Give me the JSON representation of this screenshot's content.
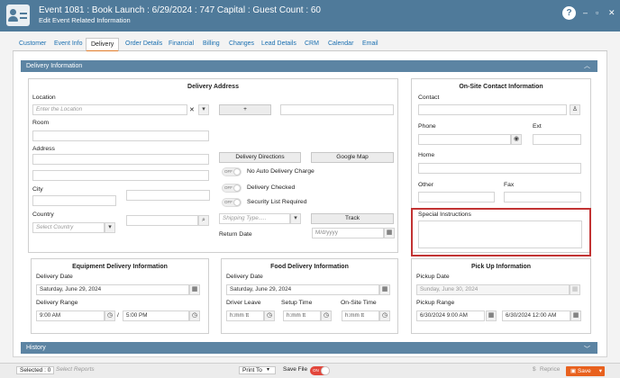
{
  "header": {
    "title": "Event 1081 : Book Launch : 6/29/2024 : 747 Capital : Guest Count : 60",
    "subtitle": "Edit Event Related Information",
    "help": "?",
    "minimize": "–",
    "restore": "▫",
    "close": "✕"
  },
  "tabs": [
    {
      "label": "Customer"
    },
    {
      "label": "Event Info"
    },
    {
      "label": "Delivery"
    },
    {
      "label": "Order Details"
    },
    {
      "label": "Financial"
    },
    {
      "label": "Billing"
    },
    {
      "label": "Changes"
    },
    {
      "label": "Lead Details"
    },
    {
      "label": "CRM"
    },
    {
      "label": "Calendar"
    },
    {
      "label": "Email"
    }
  ],
  "sections": {
    "delivery_info": "Delivery Information",
    "history": "History"
  },
  "delivery_address": {
    "title": "Delivery Address",
    "location_label": "Location",
    "location_placeholder": "Enter the Location",
    "add": "+",
    "room_label": "Room",
    "address_label": "Address",
    "city_label": "City",
    "country_label": "Country",
    "country_placeholder": "Select Country",
    "delivery_directions": "Delivery Directions",
    "google_map": "Google Map",
    "off": "OFF",
    "no_auto_charge": "No Auto Delivery Charge",
    "delivery_checked": "Delivery Checked",
    "security_list": "Security List Required",
    "shipping_placeholder": "Shipping Type.....",
    "track": "Track",
    "return_date_label": "Return Date",
    "return_date_placeholder": "M/d/yyyy"
  },
  "onsite": {
    "title": "On-Site Contact Information",
    "contact": "Contact",
    "phone": "Phone",
    "ext": "Ext",
    "home": "Home",
    "other": "Other",
    "fax": "Fax",
    "special_instructions": "Special Instructions"
  },
  "equipment": {
    "title": "Equipment Delivery Information",
    "date_label": "Delivery Date",
    "date": "Saturday, June 29, 2024",
    "range_label": "Delivery Range",
    "from": "9:00 AM",
    "to": "5:00 PM",
    "slash": "/"
  },
  "food": {
    "title": "Food Delivery Information",
    "date_label": "Delivery Date",
    "date": "Saturday, June 29, 2024",
    "driver_leave": "Driver Leave",
    "setup_time": "Setup Time",
    "onsite_time": "On-Site Time",
    "time_ph": "h:mm tt"
  },
  "pickup": {
    "title": "Pick Up Information",
    "date_label": "Pickup Date",
    "date": "Sunday, June 30, 2024",
    "range_label": "Pickup Range",
    "from": "6/30/2024 9:00 AM",
    "to": "6/30/2024 12:00 AM"
  },
  "footer": {
    "selected": "Selected : 0",
    "select_reports": "Select Reports",
    "print_to": "Print To",
    "save_file": "Save File",
    "toggle": "ON",
    "reprice": "Reprice",
    "save": "Save"
  },
  "icons": {
    "clear": "✕",
    "dropdown": "▾",
    "search": "⌕",
    "calendar": "▦",
    "clock": "◷",
    "person": "♙",
    "globe": "◉",
    "chevron": "︿",
    "dollar": "$",
    "save": "▣"
  }
}
